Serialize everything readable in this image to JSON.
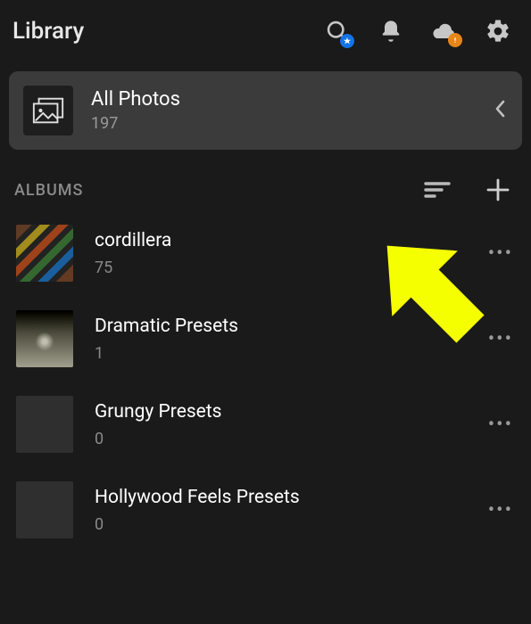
{
  "header": {
    "title": "Library"
  },
  "allPhotos": {
    "title": "All Photos",
    "count": "197"
  },
  "sections": {
    "albumsLabel": "ALBUMS"
  },
  "albums": [
    {
      "name": "cordillera",
      "count": "75",
      "thumbClass": "thumb-cordillera"
    },
    {
      "name": "Dramatic Presets",
      "count": "1",
      "thumbClass": "thumb-dramatic"
    },
    {
      "name": "Grungy Presets",
      "count": "0",
      "thumbClass": ""
    },
    {
      "name": "Hollywood Feels Presets",
      "count": "0",
      "thumbClass": ""
    }
  ],
  "colors": {
    "arrow": "#f6ff00"
  }
}
